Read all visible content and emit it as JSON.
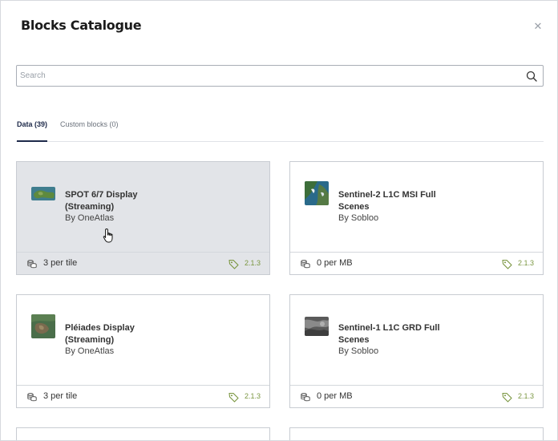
{
  "modal": {
    "title": "Blocks Catalogue",
    "close_icon": "close-icon"
  },
  "search": {
    "placeholder": "Search",
    "value": "",
    "icon": "search-icon"
  },
  "tabs": [
    {
      "label": "Data (39)",
      "active": true
    },
    {
      "label": "Custom blocks (0)",
      "active": false
    }
  ],
  "cards": [
    {
      "name": "SPOT 6/7 Display (Streaming)",
      "by": "By OneAtlas",
      "cost": "3 per tile",
      "version": "2.1.3",
      "hovered": true
    },
    {
      "name": "Sentinel-2 L1C MSI Full Scenes",
      "by": "By Sobloo",
      "cost": "0 per MB",
      "version": "2.1.3",
      "hovered": false
    },
    {
      "name": "Pléiades Display (Streaming)",
      "by": "By OneAtlas",
      "cost": "3 per tile",
      "version": "2.1.3",
      "hovered": false
    },
    {
      "name": "Sentinel-1 L1C GRD Full Scenes",
      "by": "By Sobloo",
      "cost": "0 per MB",
      "version": "2.1.3",
      "hovered": false
    }
  ],
  "colors": {
    "accent": "#1e2a4a",
    "version": "#7a9640",
    "card_hover_bg": "#e2e4e8"
  }
}
